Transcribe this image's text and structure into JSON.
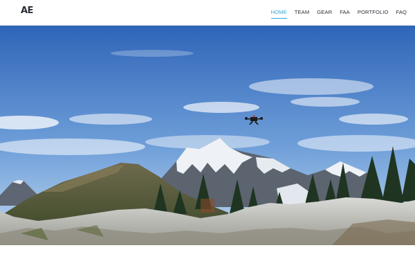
{
  "header": {
    "logo_text": "AE",
    "nav": [
      {
        "label": "HOME",
        "active": true
      },
      {
        "label": "TEAM",
        "active": false
      },
      {
        "label": "GEAR",
        "active": false
      },
      {
        "label": "FAA",
        "active": false
      },
      {
        "label": "PORTFOLIO",
        "active": false
      },
      {
        "label": "FAQ",
        "active": false
      }
    ]
  },
  "hero": {
    "image": "mountain-landscape-with-drone",
    "subject_icon": "drone-icon"
  },
  "colors": {
    "accent": "#2aa8d4",
    "nav_text": "#2b2f36",
    "sky_top": "#2f65b8",
    "sky_bottom": "#a9c8ea"
  }
}
